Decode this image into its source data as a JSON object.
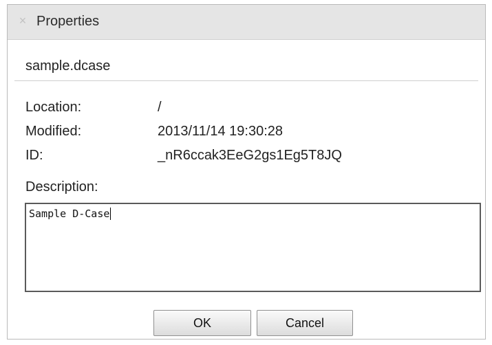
{
  "window": {
    "title": "Properties",
    "close_icon": "close-icon"
  },
  "file": {
    "name": "sample.dcase"
  },
  "properties": {
    "location_label": "Location:",
    "location_value": "/",
    "modified_label": "Modified:",
    "modified_value": "2013/11/14 19:30:28",
    "id_label": "ID:",
    "id_value": "_nR6ccak3EeG2gs1Eg5T8JQ"
  },
  "description": {
    "label": "Description:",
    "value": "Sample D-Case"
  },
  "buttons": {
    "ok_label": "OK",
    "cancel_label": "Cancel"
  },
  "colors": {
    "titlebar_bg": "#e5e5e5",
    "border": "#b9b9b9",
    "text_border": "#5a5a5a"
  }
}
